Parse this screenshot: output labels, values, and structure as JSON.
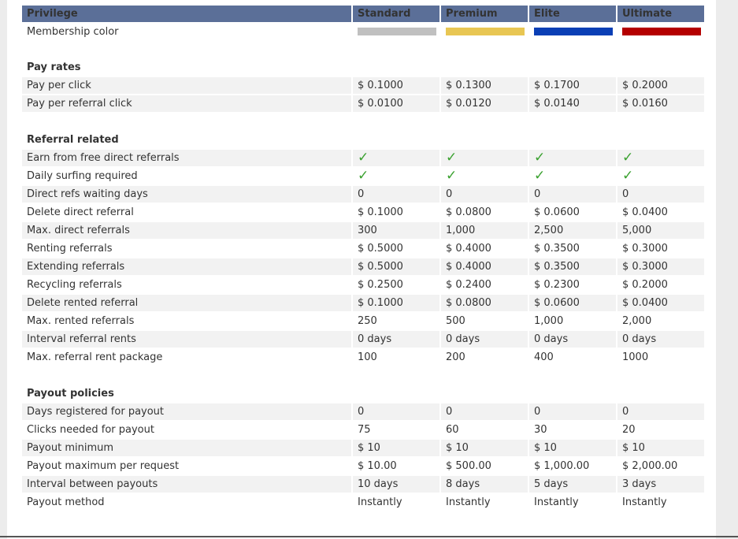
{
  "header": {
    "privilege": "Privilege",
    "standard": "Standard",
    "premium": "Premium",
    "elite": "Elite",
    "ultimate": "Ultimate"
  },
  "membership": {
    "label": "Membership color",
    "colors": [
      "#c0c0c0",
      "#e8c653",
      "#0a3fb5",
      "#b40000"
    ]
  },
  "sections": {
    "pay_rates": "Pay rates",
    "referral_related": "Referral related",
    "payout_policies": "Payout policies"
  },
  "rows": {
    "ppc": {
      "label": "Pay per click",
      "v": [
        "$ 0.1000",
        "$ 0.1300",
        "$ 0.1700",
        "$ 0.2000"
      ]
    },
    "pprc": {
      "label": "Pay per referral click",
      "v": [
        "$ 0.0100",
        "$ 0.0120",
        "$ 0.0140",
        "$ 0.0160"
      ]
    },
    "earn_free": {
      "label": "Earn from free direct referrals",
      "v": [
        "✓",
        "✓",
        "✓",
        "✓"
      ]
    },
    "daily": {
      "label": "Daily surfing required",
      "v": [
        "✓",
        "✓",
        "✓",
        "✓"
      ]
    },
    "waiting": {
      "label": "Direct refs waiting days",
      "v": [
        "0",
        "0",
        "0",
        "0"
      ]
    },
    "del_direct": {
      "label": "Delete direct referral",
      "v": [
        "$ 0.1000",
        "$ 0.0800",
        "$ 0.0600",
        "$ 0.0400"
      ]
    },
    "max_direct": {
      "label": "Max. direct referrals",
      "v": [
        "300",
        "1,000",
        "2,500",
        "5,000"
      ]
    },
    "renting": {
      "label": "Renting referrals",
      "v": [
        "$ 0.5000",
        "$ 0.4000",
        "$ 0.3500",
        "$ 0.3000"
      ]
    },
    "extending": {
      "label": "Extending referrals",
      "v": [
        "$ 0.5000",
        "$ 0.4000",
        "$ 0.3500",
        "$ 0.3000"
      ]
    },
    "recycling": {
      "label": "Recycling referrals",
      "v": [
        "$ 0.2500",
        "$ 0.2400",
        "$ 0.2300",
        "$ 0.2000"
      ]
    },
    "del_rented": {
      "label": "Delete rented referral",
      "v": [
        "$ 0.1000",
        "$ 0.0800",
        "$ 0.0600",
        "$ 0.0400"
      ]
    },
    "max_rented": {
      "label": "Max. rented referrals",
      "v": [
        "250",
        "500",
        "1,000",
        "2,000"
      ]
    },
    "interval_rents": {
      "label": "Interval referral rents",
      "v": [
        "0 days",
        "0 days",
        "0 days",
        "0 days"
      ]
    },
    "max_package": {
      "label": "Max. referral rent package",
      "v": [
        "100",
        "200",
        "400",
        "1000"
      ]
    },
    "days_reg": {
      "label": "Days registered for payout",
      "v": [
        "0",
        "0",
        "0",
        "0"
      ]
    },
    "clicks_needed": {
      "label": "Clicks needed for payout",
      "v": [
        "75",
        "60",
        "30",
        "20"
      ]
    },
    "payout_min": {
      "label": "Payout minimum",
      "v": [
        "$ 10",
        "$ 10",
        "$ 10",
        "$ 10"
      ]
    },
    "payout_max": {
      "label": "Payout maximum per request",
      "v": [
        "$ 10.00",
        "$ 500.00",
        "$ 1,000.00",
        "$ 2,000.00"
      ]
    },
    "interval_payouts": {
      "label": "Interval between payouts",
      "v": [
        "10 days",
        "8 days",
        "5 days",
        "3 days"
      ]
    },
    "payout_method": {
      "label": "Payout method",
      "v": [
        "Instantly",
        "Instantly",
        "Instantly",
        "Instantly"
      ]
    }
  }
}
